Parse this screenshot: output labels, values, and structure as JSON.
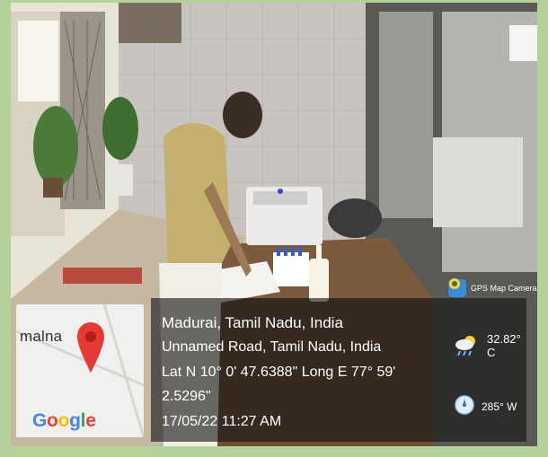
{
  "map": {
    "place_label": "malna",
    "place_label_tail": "m",
    "brand": [
      "G",
      "o",
      "o",
      "g",
      "l",
      "e"
    ]
  },
  "badge": {
    "app_name": "GPS Map Camera"
  },
  "location": {
    "city": "Madurai, Tamil Nadu, India",
    "address": "Unnamed Road, Tamil Nadu, India",
    "coords_line1": "Lat N 10° 0' 47.6388\" Long E 77° 59'",
    "coords_line2": "2.5296\"",
    "datetime": "17/05/22 11:27 AM"
  },
  "weather": {
    "temperature": "32.82° C",
    "wind": "285° W",
    "icon": "partly-cloudy-rain-icon",
    "wind_icon": "compass-icon"
  },
  "colors": {
    "frame": "#b5d19a",
    "pin": "#e53935",
    "overlay": "#141414"
  }
}
